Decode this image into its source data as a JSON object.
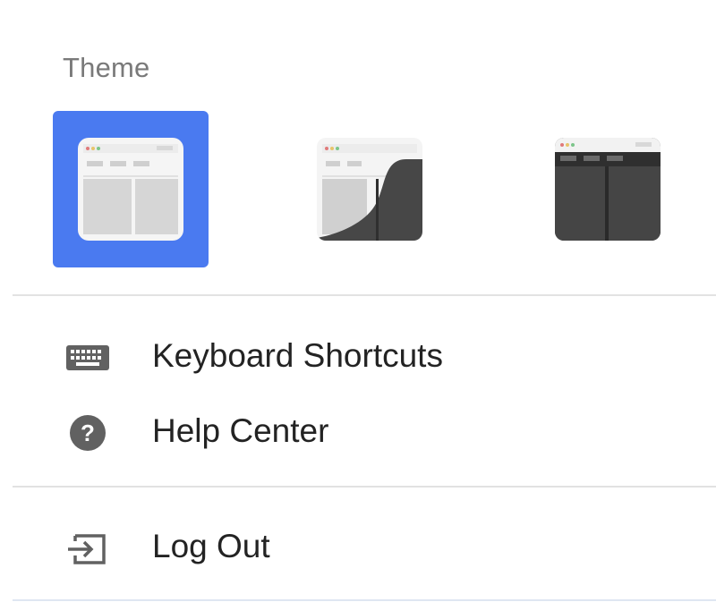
{
  "theme": {
    "section_label": "Theme",
    "options": [
      {
        "name": "Light",
        "selected": true
      },
      {
        "name": "Auto",
        "selected": false
      },
      {
        "name": "Dark",
        "selected": false
      }
    ],
    "accent_color": "#4a7af0"
  },
  "menu": {
    "items": [
      {
        "label": "Keyboard Shortcuts",
        "icon": "keyboard-icon"
      },
      {
        "label": "Help Center",
        "icon": "help-circle-icon"
      },
      {
        "label": "Log Out",
        "icon": "logout-icon"
      }
    ]
  }
}
